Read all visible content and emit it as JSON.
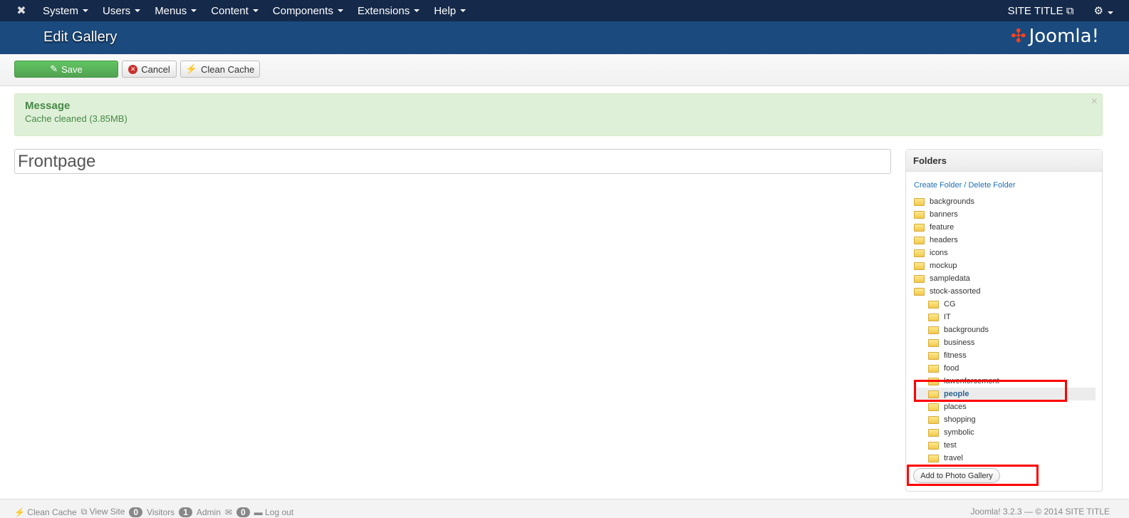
{
  "nav": {
    "menus": [
      "System",
      "Users",
      "Menus",
      "Content",
      "Components",
      "Extensions",
      "Help"
    ],
    "site_title": "SITE TITLE"
  },
  "header": {
    "title": "Edit Gallery",
    "brand": "Joomla!"
  },
  "toolbar": {
    "save": "Save",
    "cancel": "Cancel",
    "clean_cache": "Clean Cache"
  },
  "message": {
    "heading": "Message",
    "text": "Cache cleaned (3.85MB)"
  },
  "gallery": {
    "title": "Frontpage"
  },
  "folders": {
    "heading": "Folders",
    "create": "Create Folder",
    "separator": "/",
    "delete": "Delete Folder",
    "items": [
      {
        "name": "backgrounds",
        "sub": false
      },
      {
        "name": "banners",
        "sub": false
      },
      {
        "name": "feature",
        "sub": false
      },
      {
        "name": "headers",
        "sub": false
      },
      {
        "name": "icons",
        "sub": false
      },
      {
        "name": "mockup",
        "sub": false
      },
      {
        "name": "sampledata",
        "sub": false
      },
      {
        "name": "stock-assorted",
        "sub": false,
        "open": true
      },
      {
        "name": "CG",
        "sub": true
      },
      {
        "name": "IT",
        "sub": true
      },
      {
        "name": "backgrounds",
        "sub": true
      },
      {
        "name": "business",
        "sub": true
      },
      {
        "name": "fitness",
        "sub": true
      },
      {
        "name": "food",
        "sub": true
      },
      {
        "name": "lawenforcement",
        "sub": true
      },
      {
        "name": "people",
        "sub": true,
        "selected": true,
        "open": true
      },
      {
        "name": "places",
        "sub": true
      },
      {
        "name": "shopping",
        "sub": true
      },
      {
        "name": "symbolic",
        "sub": true
      },
      {
        "name": "test",
        "sub": true
      },
      {
        "name": "travel",
        "sub": true
      }
    ],
    "add_button": "Add to Photo Gallery"
  },
  "footer": {
    "clean_cache": "Clean Cache",
    "view_site": "View Site",
    "visitors_count": "0",
    "visitors": "Visitors",
    "admin_count": "1",
    "admin": "Admin",
    "messages_count": "0",
    "logout": "Log out",
    "version": "Joomla! 3.2.3 — © 2014 SITE TITLE"
  }
}
